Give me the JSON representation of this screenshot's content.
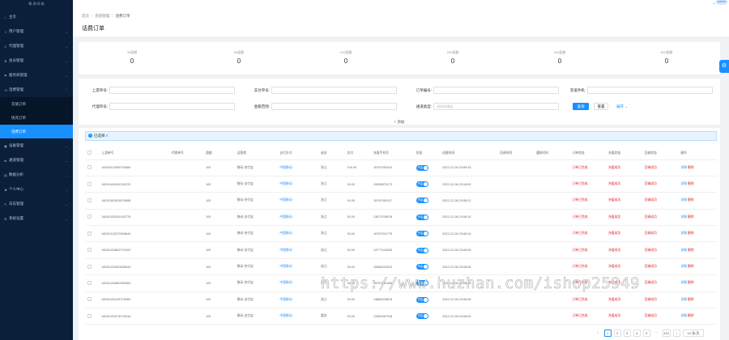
{
  "sidebar": {
    "logo": "聚 源 网 络",
    "items": [
      {
        "label": "主页",
        "icon": "home-icon",
        "glyph": "⌂"
      },
      {
        "label": "用户管理",
        "icon": "user-icon",
        "glyph": "☺"
      },
      {
        "label": "代理管理",
        "icon": "agent-icon",
        "glyph": "♙"
      },
      {
        "label": "会员管理",
        "icon": "member-icon",
        "glyph": "♛"
      },
      {
        "label": "服务商管理",
        "icon": "provider-icon",
        "glyph": "⚑"
      },
      {
        "label": "话费管理",
        "icon": "phone-bill-icon",
        "glyph": "☏"
      }
    ],
    "subitems": [
      "充值订单",
      "快充订单",
      "话费订单"
    ],
    "items_after": [
      {
        "label": "设备管理",
        "icon": "device-icon",
        "glyph": "▣"
      },
      {
        "label": "通道管理",
        "icon": "channel-icon",
        "glyph": "⇄"
      },
      {
        "label": "数据分析",
        "icon": "chart-icon",
        "glyph": "▤"
      },
      {
        "label": "个人中心",
        "icon": "profile-icon",
        "glyph": "☻"
      },
      {
        "label": "日志管理",
        "icon": "log-icon",
        "glyph": "✎"
      },
      {
        "label": "系统设置",
        "icon": "settings-icon",
        "glyph": "⚙"
      }
    ]
  },
  "topbar": {
    "avatar_text": "admin"
  },
  "header": {
    "breadcrumb": [
      "首页",
      "充值管理",
      "话费订单"
    ],
    "title": "话费订单"
  },
  "stats": [
    {
      "label": "30面额",
      "value": "0"
    },
    {
      "label": "50面额",
      "value": "0"
    },
    {
      "label": "100面额",
      "value": "0"
    },
    {
      "label": "200面额",
      "value": "0"
    },
    {
      "label": "300面额",
      "value": "0"
    },
    {
      "label": "500面额",
      "value": "0"
    }
  ],
  "filters": {
    "upstream_no": {
      "label": "上游单号:",
      "placeholder": ""
    },
    "pay_no": {
      "label": "支付单号:",
      "placeholder": ""
    },
    "order_no": {
      "label": "订单编号:",
      "placeholder": ""
    },
    "phone": {
      "label": "充值手机:",
      "placeholder": ""
    },
    "agent_no": {
      "label": "代理单号:",
      "placeholder": ""
    },
    "amount": {
      "label": "金额范围:",
      "placeholder": ""
    },
    "status": {
      "label": "通道类型:",
      "placeholder": "请选择通道"
    },
    "search_btn": "查询",
    "reset_btn": "重置",
    "expand_btn": "展开",
    "add_btn": "+ 添加"
  },
  "table": {
    "selected_text": "已选择",
    "selected_count": "0",
    "columns": [
      "上游单号",
      "代理单号",
      "面额",
      "运营商",
      "支付方式",
      "省份",
      "实付",
      "充值手机号",
      "状态",
      "创建时间",
      "回调时间",
      "通知时间",
      "订单状态",
      "充值状态",
      "回调状态",
      "操作"
    ],
    "rows": [
      {
        "no": "16001612385703484",
        "amount": "100.00",
        "carrier": "移动·充付宝",
        "pay": "中国移动",
        "province": "浙江",
        "paid": "100.00",
        "phone": "15757063010",
        "toggle": "开启",
        "time": "2022-12-06 23:59:43",
        "order": "订单已完成",
        "charge": "充值成功",
        "cb": "回调成功"
      },
      {
        "no": "16001443161026720",
        "amount": "100.00",
        "carrier": "移动·支付宝",
        "pay": "中国移动",
        "province": "浙江",
        "paid": "50.00",
        "phone": "15505875173",
        "toggle": "开启",
        "time": "2022-12-06 23:18:00",
        "order": "订单已完成",
        "charge": "充值成功",
        "cb": "回调成功"
      },
      {
        "no": "16001361503576968",
        "amount": "100.00",
        "carrier": "移动·充付宝",
        "pay": "中国移动",
        "province": "浙江",
        "paid": "50.00",
        "phone": "15757061017",
        "toggle": "开启",
        "time": "2022-12-06 23:08:21",
        "order": "订单已完成",
        "charge": "充值成功",
        "cb": "回调成功"
      },
      {
        "no": "16001433291433778",
        "amount": "100.00",
        "carrier": "移动·支付宝",
        "pay": "中国移动",
        "province": "浙江",
        "paid": "50.00",
        "phone": "13573706078",
        "toggle": "开启",
        "time": "2022-12-06 23:08:10",
        "order": "订单已完成",
        "charge": "充值成功",
        "cb": "回调成功"
      },
      {
        "no": "16001313370306843",
        "amount": "100.00",
        "carrier": "移动·充付宝",
        "pay": "中国移动",
        "province": "浙江",
        "paid": "50.00",
        "phone": "15757001775",
        "toggle": "开启",
        "time": "2022-12-06 23:08:10",
        "order": "订单已完成",
        "charge": "充值成功",
        "cb": "回调成功"
      },
      {
        "no": "16001431862707622",
        "amount": "100.00",
        "carrier": "移动·支付宝",
        "pay": "中国移动",
        "province": "浙江",
        "paid": "50.00",
        "phone": "13777440026",
        "toggle": "开启",
        "time": "2022-12-06 23:08:08",
        "order": "订单已完成",
        "charge": "充值成功",
        "cb": "回调成功"
      },
      {
        "no": "16001431060835044",
        "amount": "100.00",
        "carrier": "移动·充付宝",
        "pay": "中国移动",
        "province": "浙江",
        "paid": "50.00",
        "phone": "15968234510",
        "toggle": "开启",
        "time": "2022-12-06 23:08:08",
        "order": "订单已完成",
        "charge": "充值成功",
        "cb": "回调成功"
      },
      {
        "no": "16001431880353460",
        "amount": "100.00",
        "carrier": "移动·充付宝",
        "pay": "中国移动",
        "province": "浙江",
        "paid": "50.00",
        "phone": "15757061084",
        "toggle": "开启",
        "time": "2022-12-06 23:08:08",
        "order": "订单已完成",
        "charge": "充值成功",
        "cb": "回调成功"
      },
      {
        "no": "16001431129173080",
        "amount": "100.00",
        "carrier": "移动·支付宝",
        "pay": "中国移动",
        "province": "浙江",
        "paid": "50.00",
        "phone": "13868205678",
        "toggle": "开启",
        "time": "2022-12-06 23:08:08",
        "order": "订单已完成",
        "charge": "充值成功",
        "cb": "回调成功"
      },
      {
        "no": "16001431074076044",
        "amount": "100.00",
        "carrier": "移动·支付宝",
        "pay": "中国移动",
        "province": "重庆",
        "paid": "50.00",
        "phone": "13452387318",
        "toggle": "开启",
        "time": "2022-12-06 23:08:00",
        "order": "订单已完成",
        "charge": "充值成功",
        "cb": "回调成功"
      }
    ],
    "edit_label": "详情",
    "delete_label": "删除"
  },
  "pager": {
    "pages": [
      "1",
      "2",
      "3",
      "4",
      "5",
      "···",
      "112"
    ],
    "size": "10 条/页"
  },
  "watermark": "https://www.huzhan.com/ishop25949"
}
